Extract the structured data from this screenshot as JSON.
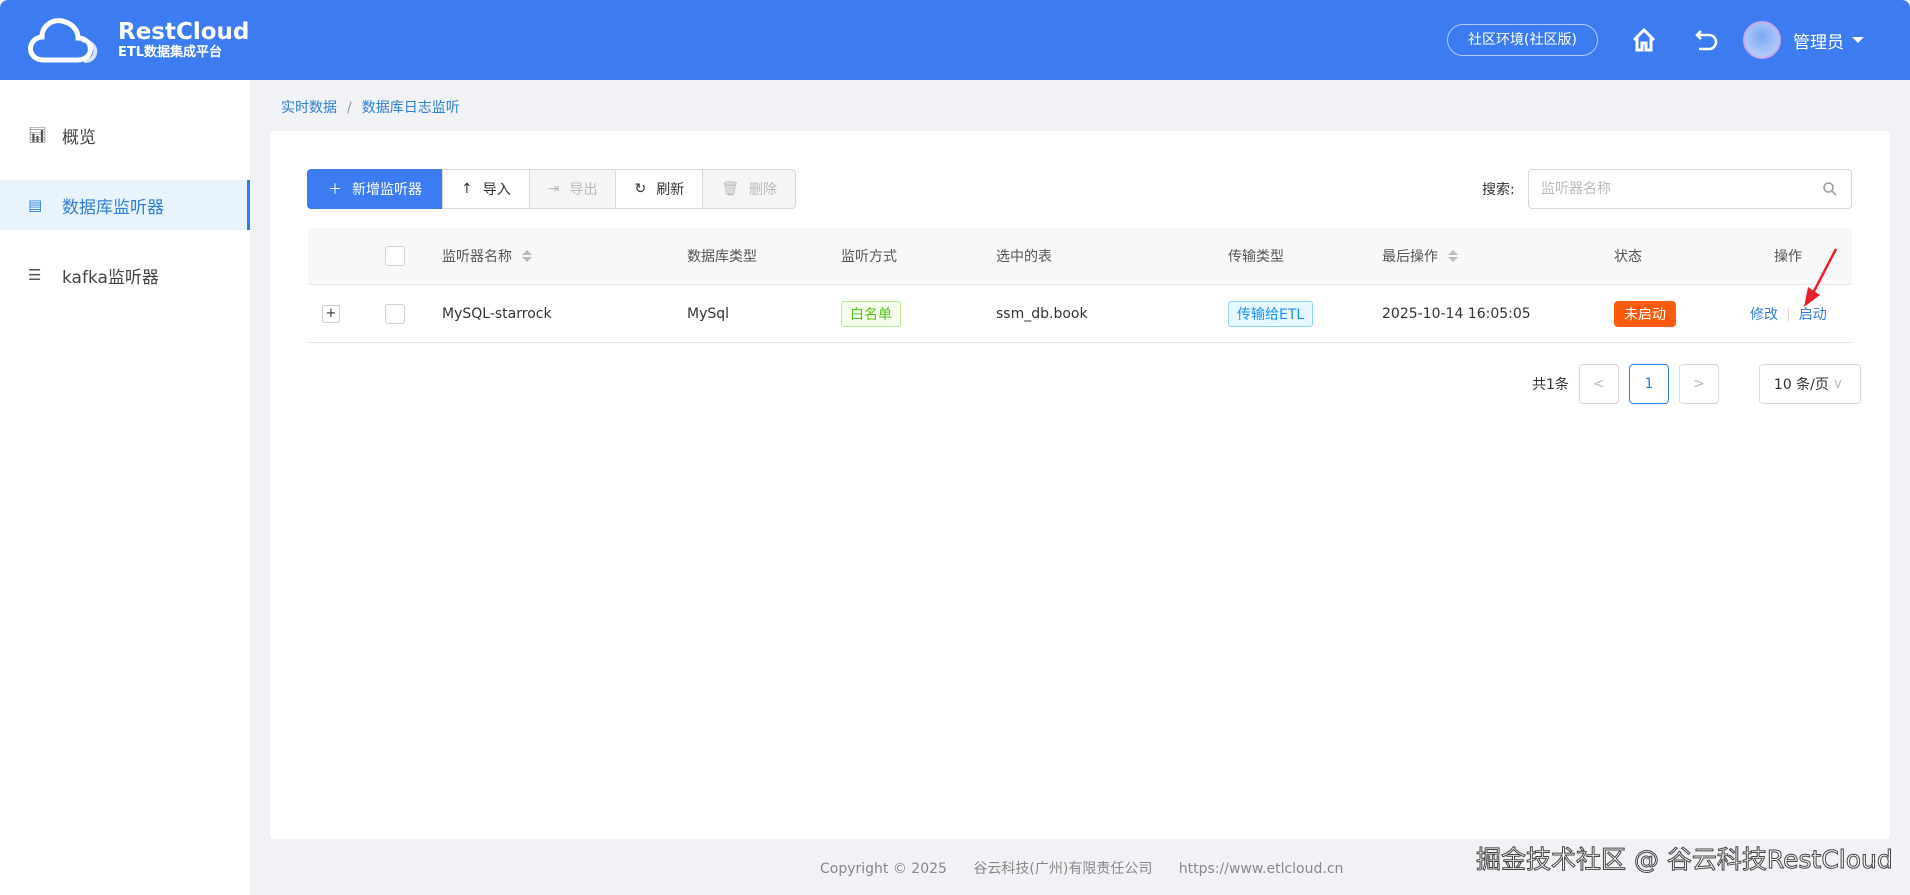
{
  "header": {
    "logo_title": "RestCloud",
    "logo_subtitle": "ETL数据集成平台",
    "env_label": "社区环境(社区版)",
    "user_name": "管理员"
  },
  "sidebar": {
    "items": [
      {
        "label": "概览",
        "icon": "bar-chart-icon"
      },
      {
        "label": "数据库监听器",
        "icon": "database-icon",
        "active": true
      },
      {
        "label": "kafka监听器",
        "icon": "list-icon"
      }
    ]
  },
  "breadcrumb": [
    "实时数据",
    "/",
    "数据库日志监听"
  ],
  "toolbar": {
    "add": "新增监听器",
    "import": "导入",
    "export": "导出",
    "refresh": "刷新",
    "delete": "删除"
  },
  "search": {
    "label": "搜索:",
    "placeholder": "监听器名称",
    "value": ""
  },
  "table": {
    "columns": [
      "监听器名称",
      "数据库类型",
      "监听方式",
      "选中的表",
      "传输类型",
      "最后操作",
      "状态",
      "操作"
    ],
    "rows": [
      {
        "name": "MySQL-starrock",
        "db_type": "MySql",
        "mode": "白名单",
        "table": "ssm_db.book",
        "transfer": "传输给ETL",
        "last_op": "2025-10-14 16:05:05",
        "status": "未启动",
        "actions": [
          "修改",
          "|",
          "启动"
        ]
      }
    ]
  },
  "pagination": {
    "total": "共1条",
    "current": "1",
    "page_size": "10 条/页"
  },
  "footer": {
    "copyright": "Copyright © 2025",
    "company": "谷云科技(广州)有限责任公司",
    "url": "https://www.etlcloud.cn"
  },
  "watermark": "掘金技术社区 @ 谷云科技RestCloud",
  "colors": {
    "primary": "#3c7cf0",
    "link": "#2f80d8",
    "status_stopped": "#fa5a0a"
  }
}
